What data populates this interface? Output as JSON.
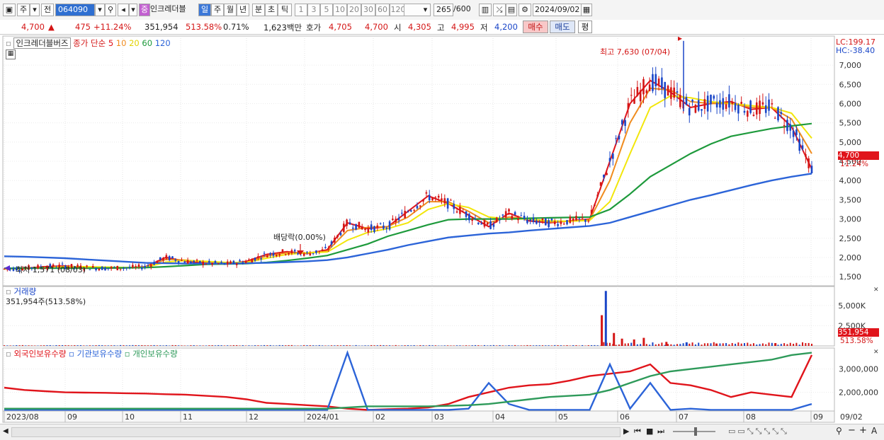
{
  "toolbar": {
    "market": "주",
    "prev_label": "전",
    "stock_code": "064090",
    "stock_badge": "중",
    "stock_name": "인크레더블",
    "period_day": "일",
    "period_week": "주",
    "period_month": "월",
    "period_year": "년",
    "period_min": "분",
    "period_sec": "초",
    "period_tick": "틱",
    "intervals": [
      "1",
      "3",
      "5",
      "10",
      "20",
      "30",
      "60",
      "120"
    ],
    "count": "265",
    "count_total": "/600",
    "date": "2024/09/02"
  },
  "quote": {
    "price": "4,700",
    "change": "475",
    "change_pct": "+11.24%",
    "volume": "351,954",
    "volume_pct": "513.58%",
    "turnover_pct": "0.71%",
    "amount": "1,623백만",
    "bid_label": "호가",
    "bid1": "4,705",
    "bid2": "4,700",
    "open_label": "시",
    "open": "4,305",
    "high_label": "고",
    "high": "4,995",
    "low_label": "저",
    "low": "4,200",
    "buy_label": "매수",
    "sell_label": "매도",
    "eval_label": "평"
  },
  "colors": {
    "up": "#d41616",
    "down": "#1a46c8",
    "ma5": "#e0141b",
    "ma10": "#f08c1e",
    "ma20": "#f2e60a",
    "ma60": "#1e9a3c",
    "ma120": "#2c64d8",
    "foreign": "#e0141b",
    "institution": "#2c64d8",
    "individual": "#2e9a5a"
  },
  "chart_data": [
    {
      "type": "line",
      "panel": "price",
      "title": "인크레더블버즈",
      "legend_prefix": "종가 단순",
      "legend_periods": [
        "5",
        "10",
        "20",
        "60",
        "120"
      ],
      "x": [
        "2023/08",
        "09",
        "10",
        "11",
        "12",
        "2024/01",
        "02",
        "03",
        "04",
        "05",
        "06",
        "07",
        "08",
        "09"
      ],
      "annotations": {
        "high": "최고 7,630 (07/04)",
        "low": "최저 1,571 (08/03)",
        "dividend": "배당락(0.00%)"
      },
      "y_ticks": [
        "7,000",
        "6,500",
        "6,000",
        "5,500",
        "5,000",
        "4,500",
        "4,000",
        "3,500",
        "3,000",
        "2,500",
        "2,000",
        "1,500"
      ],
      "ylim": [
        1300,
        7700
      ],
      "lc": "LC:199.17",
      "hc": "HC:-38.40",
      "last_price_label": "4,700",
      "last_pct_label": "11.24%",
      "series": [
        {
          "name": "5",
          "values": [
            1700,
            1720,
            1760,
            1780,
            1740,
            1720,
            1730,
            1760,
            2000,
            1900,
            1850,
            1830,
            1900,
            2080,
            2150,
            2100,
            2200,
            2900,
            2750,
            2800,
            3200,
            3600,
            3400,
            3100,
            2800,
            3150,
            2950,
            2900,
            2950,
            3000,
            4500,
            6000,
            6600,
            6300,
            5900,
            6000,
            6050,
            5850,
            5900,
            5400,
            4300
          ]
        },
        {
          "name": "10",
          "values": [
            1710,
            1720,
            1740,
            1760,
            1760,
            1730,
            1730,
            1750,
            1950,
            1930,
            1880,
            1850,
            1870,
            2040,
            2120,
            2120,
            2160,
            2700,
            2780,
            2800,
            3050,
            3450,
            3450,
            3200,
            2900,
            3050,
            3000,
            2920,
            2940,
            2980,
            4000,
            5500,
            6400,
            6350,
            6050,
            6000,
            6000,
            5900,
            5900,
            5600,
            4700
          ]
        },
        {
          "name": "20",
          "values": [
            1700,
            1710,
            1730,
            1750,
            1760,
            1750,
            1740,
            1740,
            1880,
            1920,
            1900,
            1870,
            1870,
            1980,
            2080,
            2120,
            2140,
            2450,
            2650,
            2750,
            2900,
            3250,
            3400,
            3300,
            3050,
            3000,
            3000,
            2950,
            2940,
            2960,
            3450,
            4700,
            5900,
            6200,
            6150,
            6050,
            6000,
            5950,
            5900,
            5750,
            5100
          ]
        },
        {
          "name": "60",
          "values": [
            1720,
            1720,
            1720,
            1720,
            1720,
            1725,
            1730,
            1735,
            1760,
            1790,
            1820,
            1830,
            1840,
            1870,
            1920,
            1980,
            2050,
            2200,
            2350,
            2550,
            2700,
            2850,
            2980,
            3000,
            3000,
            3000,
            3020,
            3030,
            3040,
            3050,
            3250,
            3650,
            4100,
            4400,
            4700,
            4950,
            5150,
            5250,
            5350,
            5420,
            5480
          ]
        },
        {
          "name": "120",
          "values": [
            2030,
            2020,
            2000,
            1980,
            1950,
            1920,
            1890,
            1860,
            1850,
            1840,
            1840,
            1840,
            1850,
            1860,
            1880,
            1900,
            1930,
            2000,
            2100,
            2200,
            2320,
            2420,
            2520,
            2570,
            2620,
            2650,
            2700,
            2740,
            2780,
            2820,
            2900,
            3050,
            3200,
            3350,
            3500,
            3620,
            3750,
            3880,
            4000,
            4100,
            4180
          ]
        }
      ]
    },
    {
      "type": "bar",
      "panel": "volume",
      "title": "거래량",
      "subtitle": "351,954주(513.58%)",
      "y_ticks": [
        "5,000K",
        "2,500K"
      ],
      "ylim": [
        0,
        7000000
      ],
      "last_value_label": "351,954",
      "last_pct_label": "513.58%",
      "spikes": [
        {
          "at": 0.745,
          "value": 6800000,
          "color": "#1a46c8"
        },
        {
          "at": 0.74,
          "value": 3800000,
          "color": "#d41616"
        },
        {
          "at": 0.755,
          "value": 1600000,
          "color": "#d41616"
        },
        {
          "at": 0.765,
          "value": 900000,
          "color": "#d41616"
        },
        {
          "at": 0.78,
          "value": 800000,
          "color": "#d41616"
        },
        {
          "at": 0.792,
          "value": 1000000,
          "color": "#d41616"
        },
        {
          "at": 0.82,
          "value": 500000,
          "color": "#d41616"
        },
        {
          "at": 0.845,
          "value": 450000,
          "color": "#1a46c8"
        },
        {
          "at": 0.882,
          "value": 300000,
          "color": "#d41616"
        },
        {
          "at": 0.955,
          "value": 351954,
          "color": "#d41616"
        }
      ]
    },
    {
      "type": "line",
      "panel": "holdings",
      "series": [
        {
          "name": "외국인보유수량",
          "values": [
            2200000,
            2100000,
            2050000,
            2000000,
            1990000,
            1980000,
            1960000,
            1950000,
            1920000,
            1900000,
            1850000,
            1800000,
            1700000,
            1550000,
            1500000,
            1450000,
            1400000,
            1300000,
            1250000,
            1280000,
            1300000,
            1350000,
            1500000,
            1800000,
            2000000,
            2200000,
            2300000,
            2350000,
            2500000,
            2700000,
            2800000,
            2900000,
            3200000,
            2400000,
            2300000,
            2100000,
            1800000,
            2000000,
            1900000,
            1800000,
            3600000
          ]
        },
        {
          "name": "기관보유수량",
          "values": [
            1250000,
            1250000,
            1250000,
            1250000,
            1250000,
            1250000,
            1250000,
            1250000,
            1250000,
            1250000,
            1250000,
            1250000,
            1250000,
            1250000,
            1250000,
            1250000,
            1250000,
            3700000,
            1250000,
            1250000,
            1250000,
            1250000,
            1250000,
            1300000,
            2400000,
            1500000,
            1250000,
            1250000,
            1250000,
            1250000,
            3200000,
            1300000,
            2400000,
            1250000,
            1300000,
            1250000,
            1250000,
            1250000,
            1250000,
            1250000,
            1500000
          ]
        },
        {
          "name": "개인보유수량",
          "values": [
            1300000,
            1300000,
            1300000,
            1300000,
            1300000,
            1300000,
            1300000,
            1300000,
            1300000,
            1300000,
            1300000,
            1300000,
            1300000,
            1300000,
            1300000,
            1300000,
            1300000,
            1350000,
            1400000,
            1400000,
            1400000,
            1400000,
            1420000,
            1450000,
            1500000,
            1600000,
            1700000,
            1800000,
            1850000,
            1900000,
            2100000,
            2400000,
            2700000,
            2900000,
            3000000,
            3100000,
            3200000,
            3300000,
            3400000,
            3600000,
            3700000
          ]
        }
      ],
      "y_ticks": [
        "3,000,000",
        "2,000,000"
      ],
      "ylim": [
        1200000,
        3900000
      ]
    }
  ],
  "x_axis": {
    "labels": [
      "2023/08",
      "09",
      "10",
      "11",
      "12",
      "2024/01",
      "02",
      "03",
      "04",
      "05",
      "06",
      "07",
      "08",
      "09"
    ],
    "end_label": "09/02"
  }
}
